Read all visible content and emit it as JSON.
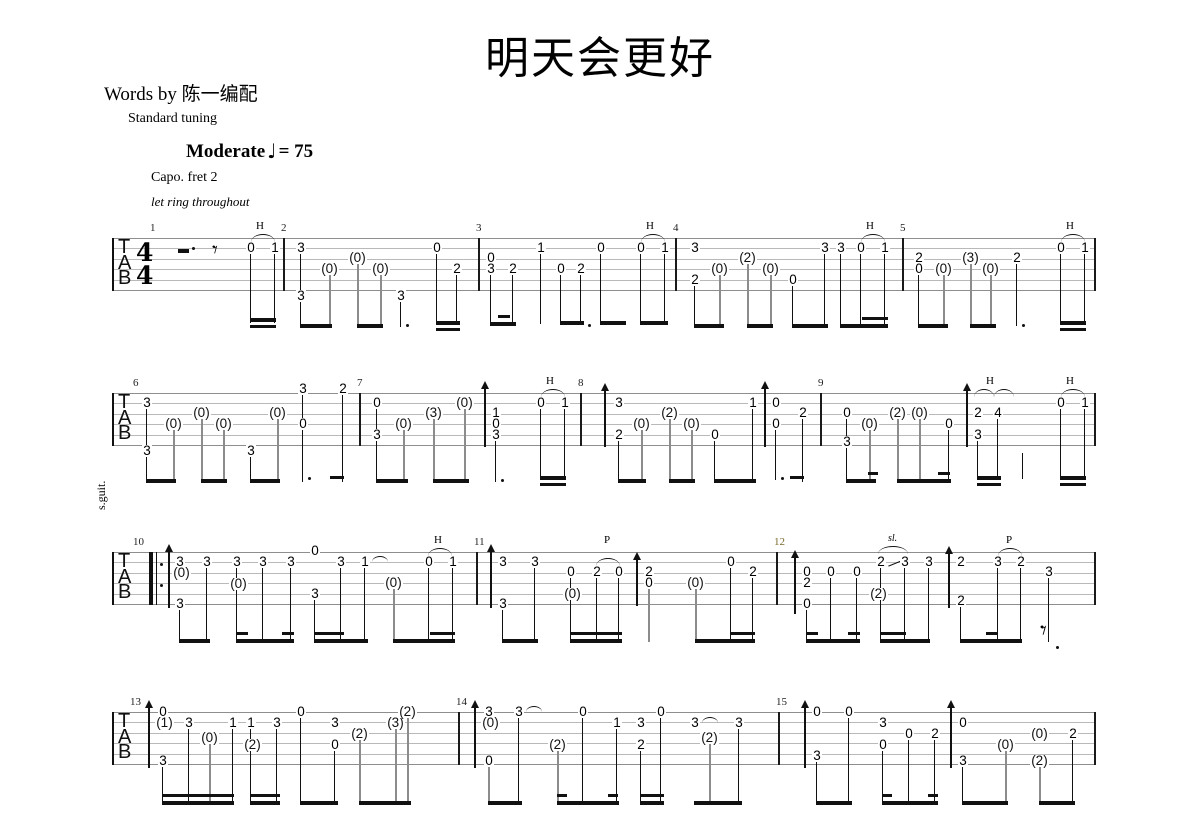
{
  "header": {
    "title": "明天会更好",
    "words_by": "Words by 陈一编配",
    "tuning": "Standard tuning",
    "tempo_label": "Moderate",
    "tempo_note": "♩",
    "tempo_eq": "= 75",
    "capo": "Capo. fret 2",
    "let_ring": "let ring throughout"
  },
  "instrument_label": "s.guit.",
  "tab_clef": {
    "line1": "T",
    "line2": "A",
    "line3": "B"
  },
  "time_signature": {
    "numerator": "4",
    "denominator": "4"
  },
  "notation_symbols": {
    "hammer_on": "H",
    "pull_off": "P",
    "slide": "sl.",
    "repeat_start": "repeat-sign",
    "arpeggio_up": "arrow-up",
    "rest_half_dotted": "dotted-half-rest",
    "rest_eighth": "eighth-rest",
    "rest_eighth_dotted": "dotted-eighth-rest"
  },
  "colors": {
    "staff_line": "#b9b9b9",
    "ink": "#111111",
    "ghost_stem": "#8c8c8c",
    "measure_tint": "#7a6a2a"
  },
  "systems": [
    {
      "index": 1,
      "measure_numbers": [
        "1",
        "2",
        "3",
        "4",
        "5"
      ],
      "ornaments": [
        "H",
        "H",
        "H",
        "H"
      ],
      "notes": "m1: rest dotted-half + eighth rest, 0-1 hammer on string1; m2: 3/3, (0), (0), (0), 3; m3: 0, 2, 0-1, 0/2/3, 2, 0, 3; m4: 3/2, (0), (2), (0), 0, 3, 3 0-1; m5: 2/0, (0), (3), (0), 2, 0-1"
    },
    {
      "index": 2,
      "measure_numbers": [
        "6",
        "7",
        "8",
        "9"
      ],
      "ornaments": [
        "H",
        "H",
        "H",
        "H"
      ],
      "notes": "m6: 3/3, (0), (0), (0), 3, (0), 3/0, 2; m7: 0/3, (0), (3), (0), 1/0/3, 0-1; m8: 3/2, (0), (2), (0), 0, 1, 0/0, 2; m9: 0/3, (0), (2), (0), 0, 2 4, 0-1"
    },
    {
      "index": 3,
      "measure_numbers": [
        "10",
        "11",
        "12"
      ],
      "ornaments": [
        "H",
        "P",
        "sl.",
        "P"
      ],
      "notes": "m10: repeat start, 3/(0)/3, 3, 3/(0), 3, 3, 0/3, 3, 1, (0), 0-1; m11: 3/3, 3, 0, 0, 2-0, 2/0, (0), 0, 2; m12: 0/2/0, 0, 0, (2), 2-slide-3, 3, 2/2, 3-2, 3, dotted eighth rest"
    },
    {
      "index": 4,
      "measure_numbers": [
        "13",
        "14",
        "15"
      ],
      "ornaments": [],
      "notes": "m13: 0/(1)/3, 3, (0), 1, 1/(2), 3, 0, 3/0, (2), (3), (2); m14: 3/(0)/0, 3, (2), 0, 1/3, 0, 3/(2), 3; m15: 0/3, 0, 3/0, 0, 2, 0/3, (0), (0)/(2), 2"
    }
  ]
}
